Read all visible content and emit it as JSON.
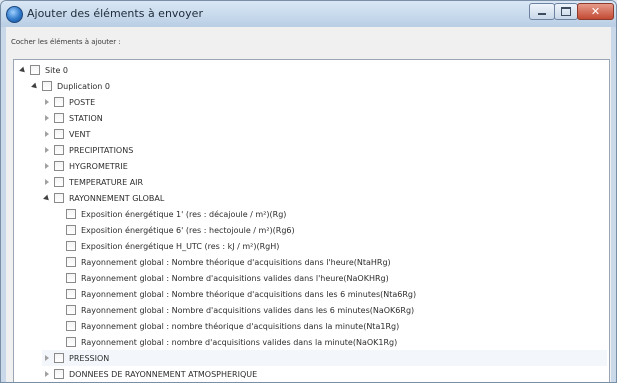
{
  "window": {
    "title": "Ajouter des éléments à envoyer",
    "close_glyph": "✕"
  },
  "instruction": "Cocher les éléments à ajouter :",
  "tree": {
    "root": {
      "label": "Site 0",
      "expanded": true,
      "checked": false
    },
    "group": {
      "label": "Duplication 0",
      "expanded": true,
      "checked": false
    },
    "categories": [
      {
        "label": "POSTE",
        "expanded": false,
        "checked": false
      },
      {
        "label": "STATION",
        "expanded": false,
        "checked": false
      },
      {
        "label": "VENT",
        "expanded": false,
        "checked": false
      },
      {
        "label": "PRECIPITATIONS",
        "expanded": false,
        "checked": false
      },
      {
        "label": "HYGROMETRIE",
        "expanded": false,
        "checked": false
      },
      {
        "label": "TEMPERATURE AIR",
        "expanded": false,
        "checked": false
      },
      {
        "label": "RAYONNEMENT GLOBAL",
        "expanded": true,
        "checked": false
      },
      {
        "label": "PRESSION",
        "expanded": false,
        "checked": false
      },
      {
        "label": "DONNEES DE RAYONNEMENT ATMOSPHERIQUE",
        "expanded": false,
        "checked": false
      }
    ],
    "rayonnement_items": [
      "Exposition énergétique 1' (res : décajoule / m²)(Rg)",
      "Exposition énergétique 6' (res : hectojoule / m²)(Rg6)",
      "Exposition énergétique H_UTC (res : kJ / m²)(RgH)",
      "Rayonnement global : Nombre théorique d'acquisitions dans l'heure(NtaHRg)",
      "Rayonnement global : Nombre d'acquisitions valides dans l'heure(NaOKHRg)",
      "Rayonnement global : Nombre théorique d'acquisitions dans les 6 minutes(Nta6Rg)",
      "Rayonnement global : Nombre d'acquisitions valides dans les 6 minutes(NaOK6Rg)",
      "Rayonnement global : nombre théorique d'acquisitions dans la minute(Nta1Rg)",
      "Rayonnement global : nombre d'acquisitions valides dans la minute(NaOK1Rg)"
    ]
  },
  "icons": {
    "app": "app-globe-icon",
    "expanded": "expanded-triangle-icon",
    "collapsed": "collapsed-triangle-icon"
  }
}
